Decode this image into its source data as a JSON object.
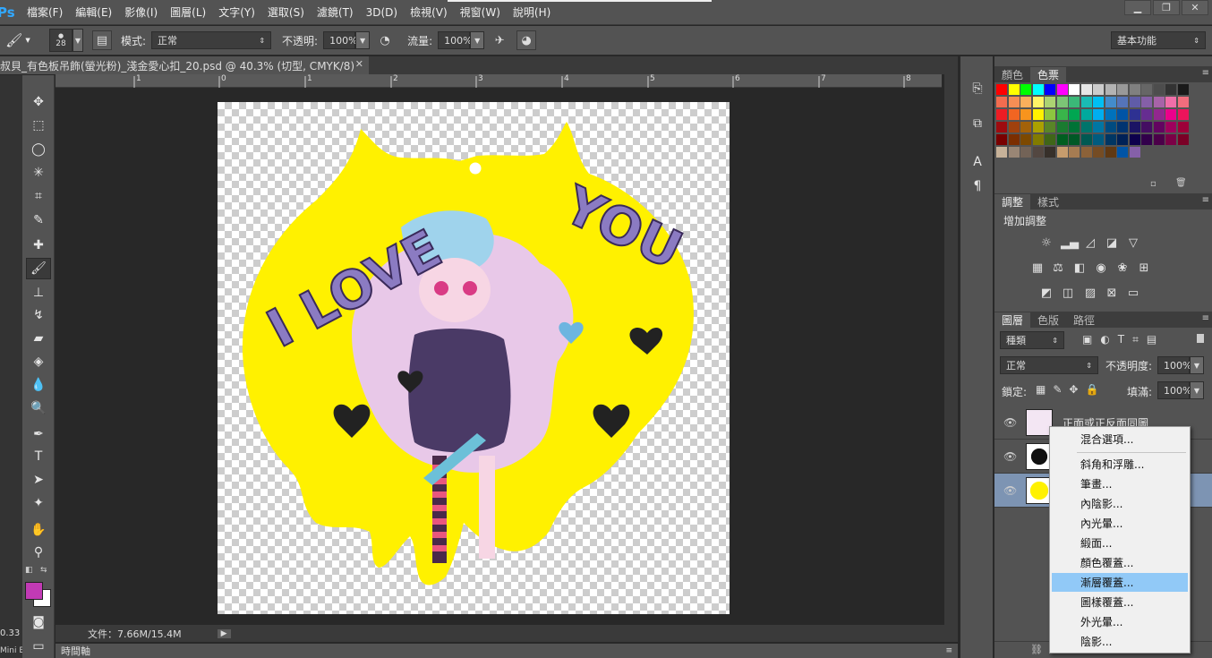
{
  "app": {
    "logo": "Ps"
  },
  "menu": [
    "檔案(F)",
    "編輯(E)",
    "影像(I)",
    "圖層(L)",
    "文字(Y)",
    "選取(S)",
    "濾鏡(T)",
    "3D(D)",
    "檢視(V)",
    "視窗(W)",
    "說明(H)"
  ],
  "window_controls": {
    "minimize": "▁",
    "restore": "❐",
    "close": "✕"
  },
  "options": {
    "brush_size": "28",
    "mode_label": "模式:",
    "mode_value": "正常",
    "opacity_label": "不透明:",
    "opacity_value": "100%",
    "flow_label": "流量:",
    "flow_value": "100%",
    "workspace": "基本功能"
  },
  "document": {
    "tab_title": "叔貝_有色板吊飾(螢光粉)_淺金愛心扣_20.psd @ 40.3% (切型, CMYK/8)",
    "close": "✕",
    "status": "文件：7.66M/15.4M",
    "zoom": "0.33",
    "timeline_label": "時間軸",
    "mini": "Mini B"
  },
  "ruler_labels": [
    "1",
    "0",
    "1",
    "2",
    "3",
    "4",
    "5",
    "6",
    "7",
    "8"
  ],
  "artwork": {
    "text": "I LOVE YOU",
    "background_color": "#fff100"
  },
  "swatches_panel": {
    "tabs": [
      "顏色",
      "色票"
    ],
    "active": "色票"
  },
  "adjustments_panel": {
    "tabs": [
      "調整",
      "樣式"
    ],
    "title": "增加調整"
  },
  "layers_panel": {
    "tabs": [
      "圖層",
      "色版",
      "路徑"
    ],
    "filter_kind": "種類",
    "blend_mode": "正常",
    "opacity_label": "不透明度:",
    "opacity_value": "100%",
    "lock_label": "鎖定:",
    "fill_label": "填滿:",
    "fill_value": "100%",
    "layers": [
      {
        "name": "正面或正反面同圖"
      },
      {
        "name": ""
      },
      {
        "name": ""
      }
    ]
  },
  "context_menu": {
    "items": [
      "混合選項...",
      "斜角和浮雕...",
      "筆畫...",
      "內陰影...",
      "內光暈...",
      "緞面...",
      "顏色覆蓋...",
      "漸層覆蓋...",
      "圖樣覆蓋...",
      "外光暈...",
      "陰影..."
    ],
    "highlighted": "漸層覆蓋..."
  },
  "colors": {
    "foreground": "#c23ab5",
    "background": "#ffffff",
    "highlight": "#91c9f7"
  }
}
